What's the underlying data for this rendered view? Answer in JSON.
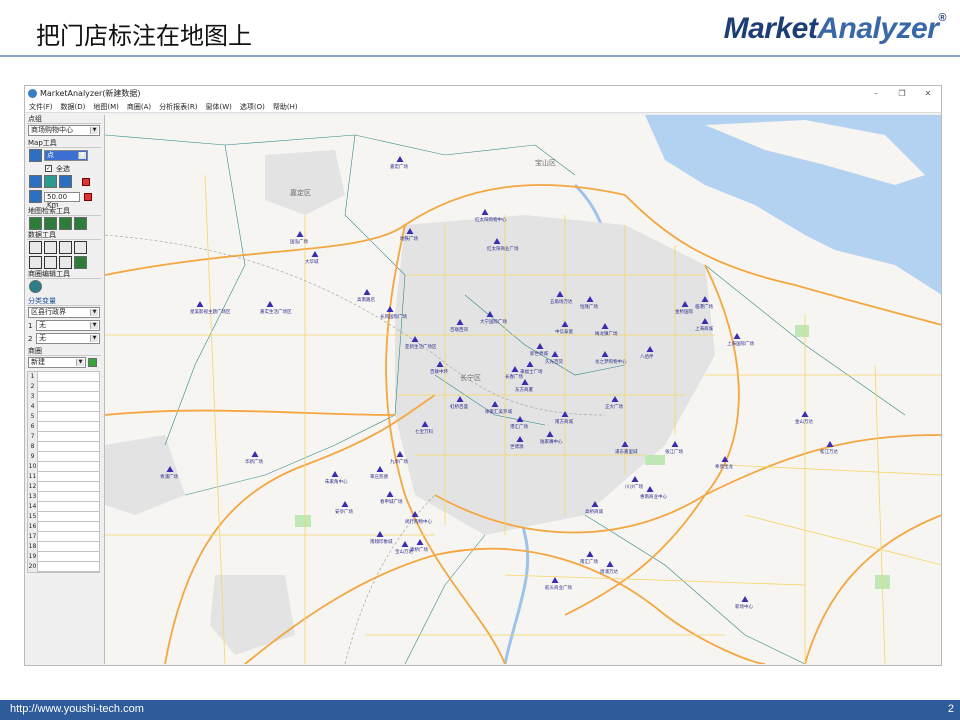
{
  "slide": {
    "title": "把门店标注在地图上",
    "brand_bold": "Market",
    "brand_light": "Analyzer",
    "brand_reg": "®",
    "footer_url": "http://www.youshi-tech.com",
    "page_number": "2"
  },
  "app": {
    "title": "MarketAnalyzer(新建数据)",
    "window_controls": [
      "–",
      "❐",
      "✕"
    ],
    "menu": [
      "文件(F)",
      "数据(D)",
      "地图(M)",
      "商圈(A)",
      "分析报表(R)",
      "窗体(W)",
      "选项(O)",
      "帮助(H)"
    ]
  },
  "left_panel": {
    "point_group_label": "点组",
    "point_group_value": "商场购物中心",
    "map_tools_label": "Map工具",
    "tool_select_value": "点",
    "select_all_label": "全选",
    "distance_value": "50.00",
    "distance_unit": "Km",
    "map_search_label": "地图检索工具",
    "data_tools_label": "数据工具",
    "trade_area_edit_label": "商圈编辑工具",
    "category_var_label": "分类变量",
    "category_var_value": "区县行政界",
    "var1_index": "1",
    "var1_value": "无",
    "var2_index": "2",
    "var2_value": "无",
    "trade_area_label": "商圈",
    "trade_area_value": "新建",
    "row_numbers": [
      "1",
      "2",
      "3",
      "4",
      "5",
      "6",
      "7",
      "8",
      "9",
      "10",
      "11",
      "12",
      "13",
      "14",
      "15",
      "16",
      "17",
      "18",
      "19",
      "20"
    ]
  },
  "map": {
    "district_labels": [
      "嘉定区",
      "宝山区",
      "长宁区"
    ],
    "stores": [
      {
        "name": "嘉宏广场"
      },
      {
        "name": "大华城"
      },
      {
        "name": "国泓广场"
      },
      {
        "name": "地铁广场"
      },
      {
        "name": "红太阳购物中心"
      },
      {
        "name": "红太阳商业广场"
      },
      {
        "name": "星美影视主题广场区"
      },
      {
        "name": "嘉实生活广场区"
      },
      {
        "name": "高南路店"
      },
      {
        "name": "长风国际广场"
      },
      {
        "name": "百联西郊"
      },
      {
        "name": "亚新生活广场区"
      },
      {
        "name": "百联中环"
      },
      {
        "name": "大宁国际广场"
      },
      {
        "name": "长春广场"
      },
      {
        "name": "五角场万达"
      },
      {
        "name": "东方商厦"
      },
      {
        "name": "新世界城"
      },
      {
        "name": "来福士广场"
      },
      {
        "name": "久光百货"
      },
      {
        "name": "恒隆广场"
      },
      {
        "name": "中信泰富"
      },
      {
        "name": "梅龙镇广场"
      },
      {
        "name": "港汇广场"
      },
      {
        "name": "徐家汇美罗城"
      },
      {
        "name": "南方商城"
      },
      {
        "name": "龙之梦购物中心"
      },
      {
        "name": "正大广场"
      },
      {
        "name": "八佰伴"
      },
      {
        "name": "金桥国际"
      },
      {
        "name": "上海商城"
      },
      {
        "name": "上海国际广场"
      },
      {
        "name": "虹桥百盛"
      },
      {
        "name": "七宝万科"
      },
      {
        "name": "九亭广场"
      },
      {
        "name": "莘庄凯德"
      },
      {
        "name": "春申城广场"
      },
      {
        "name": "闵行购物中心"
      },
      {
        "name": "世博源"
      },
      {
        "name": "陆家嘴中心"
      },
      {
        "name": "浦东嘉里城"
      },
      {
        "name": "川沙广场"
      },
      {
        "name": "张江广场"
      },
      {
        "name": "惠南商业中心"
      },
      {
        "name": "临港广场"
      },
      {
        "name": "奉贤宝龙"
      },
      {
        "name": "金山万达"
      },
      {
        "name": "松江万达"
      },
      {
        "name": "青浦广场"
      },
      {
        "name": "华新广场"
      },
      {
        "name": "朱家角中心"
      },
      {
        "name": "安亭广场"
      },
      {
        "name": "南翔印象城"
      },
      {
        "name": "宝山万达"
      },
      {
        "name": "高桥商城"
      },
      {
        "name": "周浦万达"
      },
      {
        "name": "康桥广场"
      },
      {
        "name": "航头商业广场"
      },
      {
        "name": "新场中心"
      },
      {
        "name": "南汇广场"
      }
    ]
  }
}
